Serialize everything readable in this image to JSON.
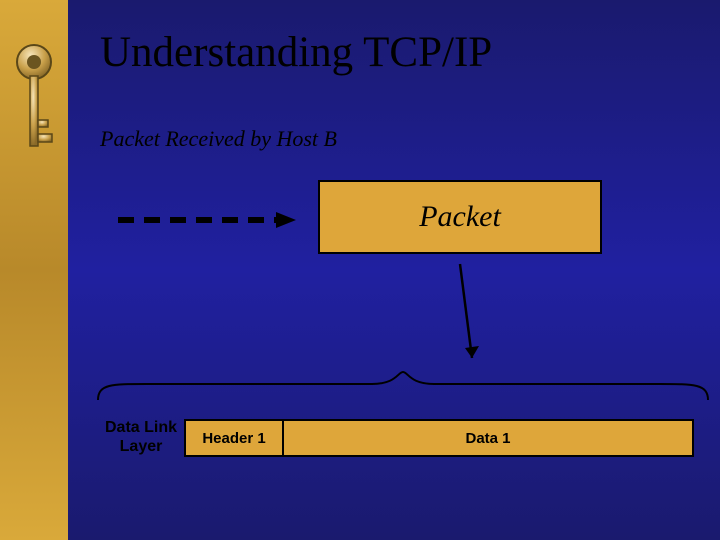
{
  "title": "Understanding TCP/IP",
  "subtitle": "Packet Received by Host B",
  "packet_label": "Packet",
  "layer": {
    "name_line1": "Data Link",
    "name_line2": "Layer",
    "header_label": "Header 1",
    "data_label": "Data 1"
  },
  "colors": {
    "bg_blue": "#1a1a6e",
    "accent_gold": "#dea63a"
  }
}
